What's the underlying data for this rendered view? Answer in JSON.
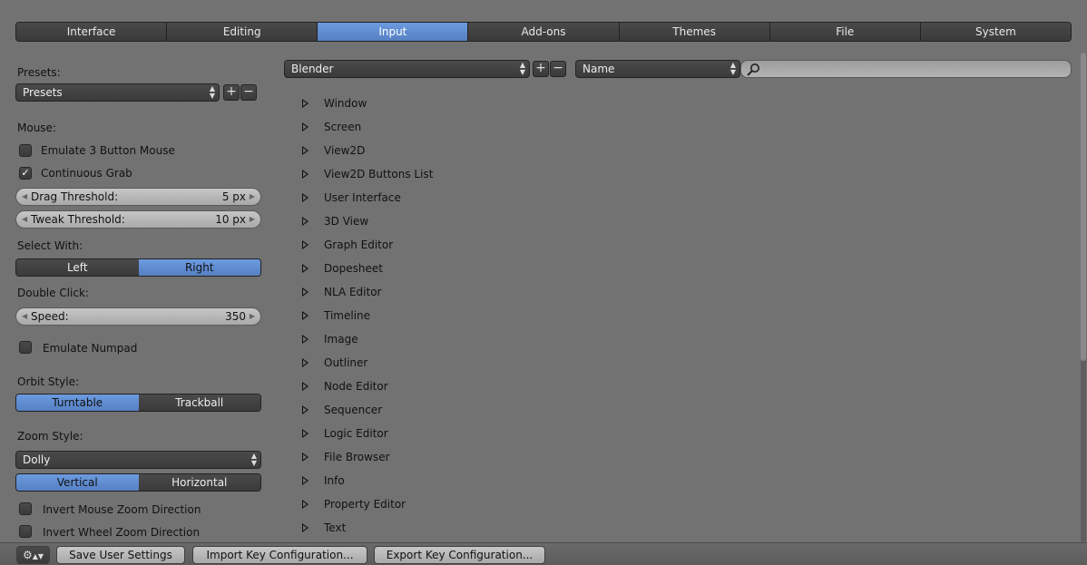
{
  "tabs": [
    {
      "label": "Interface"
    },
    {
      "label": "Editing"
    },
    {
      "label": "Input",
      "active": true
    },
    {
      "label": "Add-ons"
    },
    {
      "label": "Themes"
    },
    {
      "label": "File"
    },
    {
      "label": "System"
    }
  ],
  "left": {
    "presets_label": "Presets:",
    "presets_dropdown": "Presets",
    "mouse_label": "Mouse:",
    "emulate3_label": "Emulate 3 Button Mouse",
    "emulate3_checked": false,
    "continuous_grab_label": "Continuous Grab",
    "continuous_grab_checked": true,
    "drag_threshold_label": "Drag Threshold:",
    "drag_threshold_value": "5 px",
    "tweak_threshold_label": "Tweak Threshold:",
    "tweak_threshold_value": "10 px",
    "select_with_label": "Select With:",
    "select_left": "Left",
    "select_right": "Right",
    "select_active": "Right",
    "double_click_label": "Double Click:",
    "speed_label": "Speed:",
    "speed_value": "350",
    "emulate_numpad_label": "Emulate Numpad",
    "emulate_numpad_checked": false,
    "orbit_style_label": "Orbit Style:",
    "orbit_turntable": "Turntable",
    "orbit_trackball": "Trackball",
    "orbit_active": "Turntable",
    "zoom_style_label": "Zoom Style:",
    "zoom_style_value": "Dolly",
    "zoom_vertical": "Vertical",
    "zoom_horizontal": "Horizontal",
    "zoom_axis_active": "Vertical",
    "invert_mouse_zoom_label": "Invert Mouse Zoom Direction",
    "invert_wheel_zoom_label": "Invert Wheel Zoom Direction"
  },
  "keymap": {
    "preset_value": "Blender",
    "filter_type": "Name",
    "search_value": "",
    "items": [
      "Window",
      "Screen",
      "View2D",
      "View2D Buttons List",
      "User Interface",
      "3D View",
      "Graph Editor",
      "Dopesheet",
      "NLA Editor",
      "Timeline",
      "Image",
      "Outliner",
      "Node Editor",
      "Sequencer",
      "Logic Editor",
      "File Browser",
      "Info",
      "Property Editor",
      "Text"
    ]
  },
  "bottom": {
    "save_label": "Save User Settings",
    "import_label": "Import Key Configuration...",
    "export_label": "Export Key Configuration..."
  },
  "colors": {
    "background": "#727272",
    "accent": "#5680c2"
  }
}
